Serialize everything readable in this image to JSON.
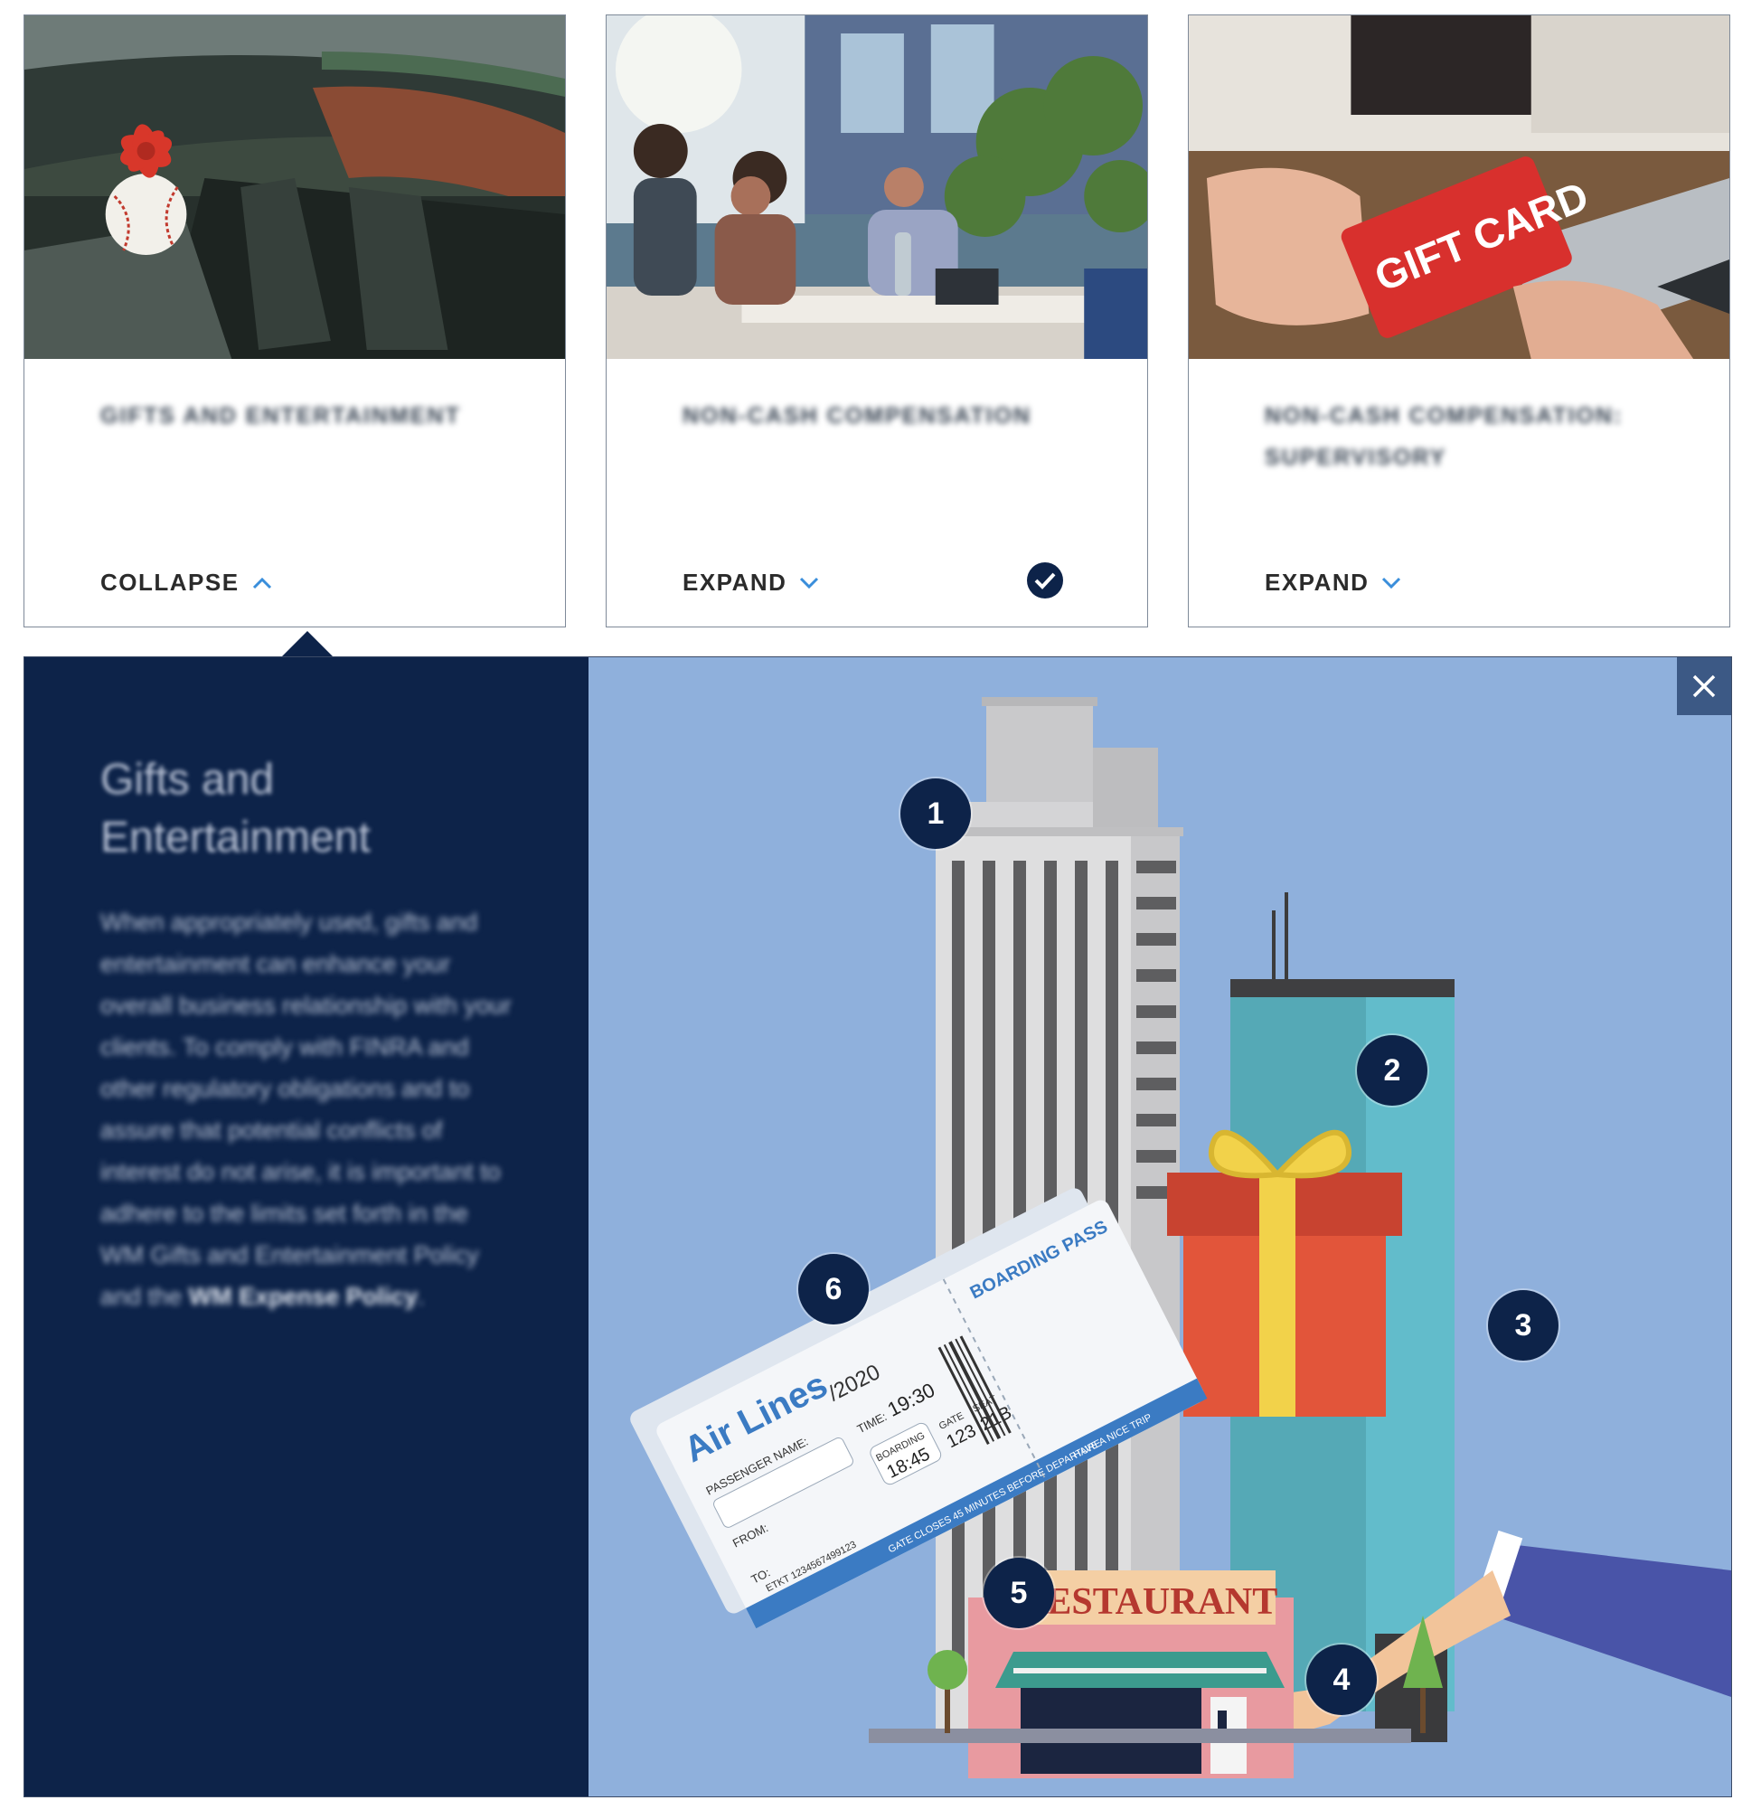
{
  "cards": [
    {
      "title": "Gifts and Entertainment",
      "toggle_label": "COLLAPSE",
      "state": "expanded",
      "completed": false
    },
    {
      "title": "Non-Cash Compensation",
      "toggle_label": "EXPAND",
      "state": "collapsed",
      "completed": true
    },
    {
      "title": "Non-Cash Compensation: Supervisory",
      "toggle_label": "EXPAND",
      "state": "collapsed",
      "completed": false
    }
  ],
  "photo_text": {
    "gift_card": "GIFT CARD"
  },
  "panel": {
    "heading": "Gifts and Entertainment",
    "body": "When appropriately used, gifts and entertainment can enhance your overall business relationship with your clients. To comply with FINRA and other regulatory obligations and to assure that potential conflicts of interest do not arise, it is important to adhere to the limits set forth in the WM Gifts and Entertainment Policy and the ",
    "body_link": "WM Expense Policy",
    "hotspots": [
      "1",
      "2",
      "3",
      "4",
      "5",
      "6"
    ]
  },
  "illustration_text": {
    "restaurant_sign": "RESTAURANT",
    "airline": "Air Lines",
    "boarding_pass": "BOARDING PASS",
    "passenger_label": "PASSENGER NAME:",
    "from_label": "FROM:",
    "to_label": "TO:",
    "date_fragment": "/2020",
    "time_label": "TIME:",
    "time_value": "19:30",
    "boarding_label": "BOARDING",
    "boarding_value": "18:45",
    "gate_label": "GATE",
    "gate_value": "123",
    "seat_label": "SEAT",
    "seat_value": "21B",
    "gate_closes": "GATE CLOSES 45 MINUTES BEFORE DEPARTURE",
    "have_nice_trip": "HAVE A NICE TRIP",
    "ticket_number": "ETKT 1234567499123"
  },
  "colors": {
    "navy": "#0d2349",
    "panel_bg": "#8fb0dc",
    "accent_blue": "#3a8edb",
    "gift_red": "#e2553a",
    "ribbon_yellow": "#f2d24a"
  },
  "icons": {
    "collapse": "chevron-up-icon",
    "expand": "chevron-down-icon",
    "completed": "check-circle-icon",
    "close": "close-icon"
  }
}
